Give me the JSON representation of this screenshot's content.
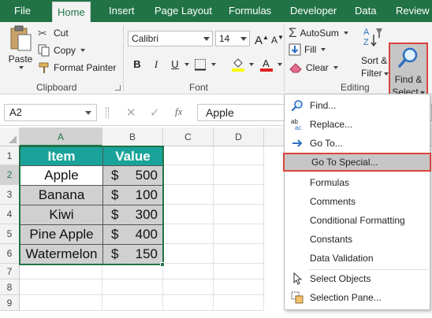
{
  "tabs": [
    "File",
    "Home",
    "Insert",
    "Page Layout",
    "Formulas",
    "Developer",
    "Data",
    "Review"
  ],
  "active_tab": "Home",
  "clipboard": {
    "paste": "Paste",
    "cut": "Cut",
    "copy": "Copy",
    "format_painter": "Format Painter",
    "group_label": "Clipboard"
  },
  "font": {
    "name": "Calibri",
    "size": "14",
    "bold": "B",
    "italic": "I",
    "underline": "U",
    "group_label": "Font",
    "fill_color": "#ffff00",
    "font_color": "#e02020"
  },
  "editing": {
    "autosum": "AutoSum",
    "fill": "Fill",
    "clear": "Clear",
    "sort_filter_1": "Sort &",
    "sort_filter_2": "Filter",
    "find_select_1": "Find &",
    "find_select_2": "Select",
    "group_label": "Editing"
  },
  "formula_bar": {
    "name_box": "A2",
    "fx": "fx",
    "value": "Apple"
  },
  "sheet": {
    "columns": [
      "A",
      "B",
      "C",
      "D"
    ],
    "rows": [
      "1",
      "2",
      "3",
      "4",
      "5",
      "6",
      "7",
      "8",
      "9"
    ],
    "header": {
      "item": "Item",
      "value": "Value"
    },
    "data": [
      {
        "item": "Apple",
        "currency": "$",
        "value": "500"
      },
      {
        "item": "Banana",
        "currency": "$",
        "value": "100"
      },
      {
        "item": "Kiwi",
        "currency": "$",
        "value": "300"
      },
      {
        "item": "Pine Apple",
        "currency": "$",
        "value": "400"
      },
      {
        "item": "Watermelon",
        "currency": "$",
        "value": "150"
      }
    ],
    "header_color": "#1aa39a"
  },
  "menu": {
    "items": [
      {
        "label": "Find...",
        "icon": "magnifier-icon"
      },
      {
        "label": "Replace...",
        "icon": "replace-icon"
      },
      {
        "label": "Go To...",
        "icon": "arrow-right-icon"
      },
      {
        "label": "Go To Special...",
        "icon": ""
      },
      {
        "label": "Formulas",
        "icon": ""
      },
      {
        "label": "Comments",
        "icon": ""
      },
      {
        "label": "Conditional Formatting",
        "icon": ""
      },
      {
        "label": "Constants",
        "icon": ""
      },
      {
        "label": "Data Validation",
        "icon": ""
      },
      {
        "label": "Select Objects",
        "icon": "pointer-icon"
      },
      {
        "label": "Selection Pane...",
        "icon": "selection-pane-icon"
      }
    ],
    "highlighted": "Go To Special..."
  },
  "colors": {
    "accent": "#217346",
    "highlight_border": "#d9463a"
  }
}
